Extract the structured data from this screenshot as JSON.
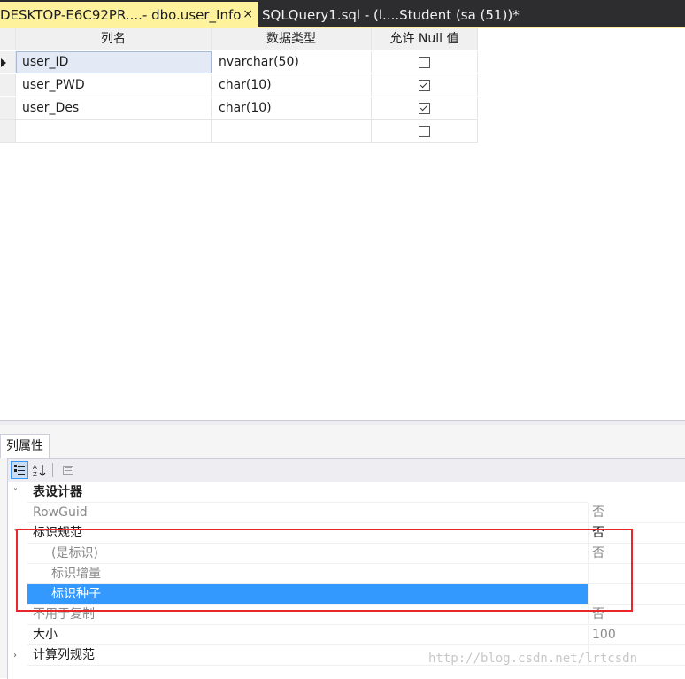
{
  "tabs": [
    {
      "title": "DESKTOP-E6C92PR....- dbo.user_Info",
      "active": true,
      "close": "×"
    },
    {
      "title": "SQLQuery1.sql - (l....Student (sa (51))*",
      "active": false
    }
  ],
  "grid": {
    "headers": {
      "name": "列名",
      "type": "数据类型",
      "nulls": "允许 Null 值"
    },
    "rows": [
      {
        "name": "user_ID",
        "type": "nvarchar(50)",
        "allow_null": false,
        "current": true
      },
      {
        "name": "user_PWD",
        "type": "char(10)",
        "allow_null": true,
        "current": false
      },
      {
        "name": "user_Des",
        "type": "char(10)",
        "allow_null": true,
        "current": false
      },
      {
        "name": "",
        "type": "",
        "allow_null": false,
        "current": false
      }
    ]
  },
  "props": {
    "tab_label": "列属性",
    "toolbar": {
      "categorized": "categorized-icon",
      "alphabetical": "sort-az-icon",
      "pages": "property-pages-icon"
    },
    "rows": [
      {
        "name": "表设计器",
        "value": "",
        "level": 0,
        "expander": "˅",
        "gray": false
      },
      {
        "name": "RowGuid",
        "value": "否",
        "level": 1,
        "expander": "",
        "gray": true
      },
      {
        "name": "标识规范",
        "value": "否",
        "level": 1,
        "expander": "˅",
        "gray": false
      },
      {
        "name": "(是标识)",
        "value": "否",
        "level": 2,
        "expander": "",
        "gray": true
      },
      {
        "name": "标识增量",
        "value": "",
        "level": 2,
        "expander": "",
        "gray": true
      },
      {
        "name": "标识种子",
        "value": "",
        "level": 2,
        "expander": "",
        "gray": false,
        "selected": true
      },
      {
        "name": "不用于复制",
        "value": "否",
        "level": 1,
        "expander": "",
        "gray": true
      },
      {
        "name": "大小",
        "value": "100",
        "level": 1,
        "expander": "",
        "gray": false
      },
      {
        "name": "计算列规范",
        "value": "",
        "level": 1,
        "expander": "›",
        "gray": false
      }
    ]
  },
  "watermark": "http://blog.csdn.net/lrtcsdn",
  "colors": {
    "active_tab": "#fff29d",
    "selection": "#3399ff",
    "highlight_box": "#e8262b"
  }
}
